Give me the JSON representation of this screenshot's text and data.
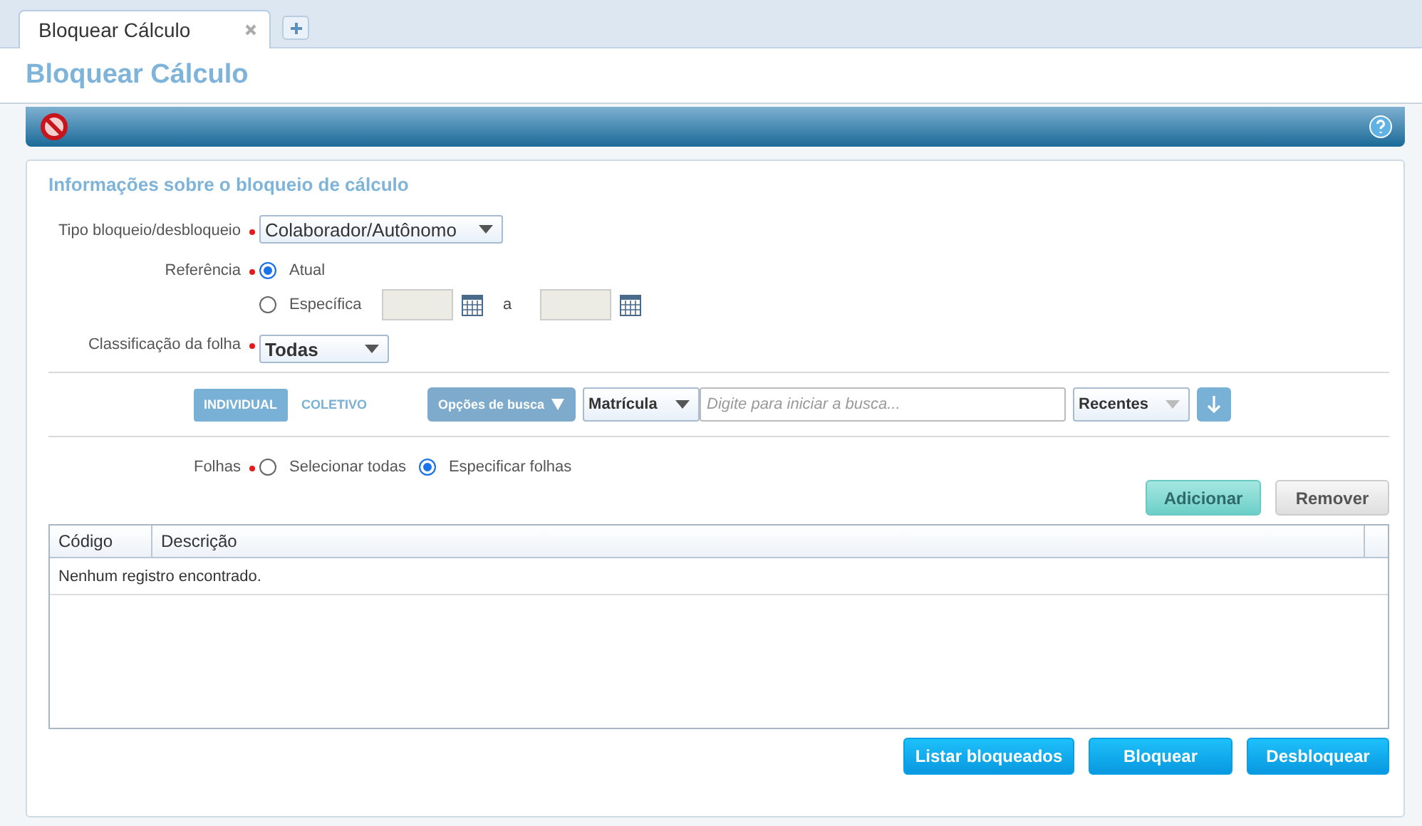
{
  "tabs": [
    {
      "label": "Bloquear Cálculo",
      "selected": true
    }
  ],
  "page_title": "Bloquear Cálculo",
  "panel": {
    "title": "Informações sobre o bloqueio de cálculo",
    "fields": [
      {
        "kind": "select",
        "label": "Tipo bloqueio/desbloqueio",
        "required": true,
        "value": "Colaborador/Autônomo"
      },
      {
        "kind": "reference",
        "label": "Referência",
        "required": true,
        "options": [
          {
            "label": "Atual",
            "selected": true
          },
          {
            "label": "Específica",
            "selected": false
          }
        ],
        "range_separator": "a"
      },
      {
        "kind": "select",
        "label": "Classificação da folha",
        "required": true,
        "value": "Todas"
      }
    ],
    "search": {
      "modes": [
        {
          "label": "INDIVIDUAL",
          "selected": true
        },
        {
          "label": "COLETIVO",
          "selected": false
        }
      ],
      "options_button": "Opções de busca",
      "field_select": "Matrícula",
      "placeholder": "Digite para iniciar a busca...",
      "history_select": "Recentes"
    },
    "folhas": {
      "label": "Folhas",
      "required": true,
      "options": [
        {
          "label": "Selecionar todas",
          "selected": false
        },
        {
          "label": "Especificar folhas",
          "selected": true
        }
      ]
    },
    "list_buttons": [
      {
        "label": "Adicionar",
        "kind": "primary"
      },
      {
        "label": "Remover",
        "kind": "secondary"
      }
    ],
    "table": {
      "columns": [
        "Código",
        "Descrição"
      ],
      "empty_message": "Nenhum registro encontrado."
    },
    "actions": [
      "Listar bloqueados",
      "Bloquear",
      "Desbloquear"
    ]
  }
}
